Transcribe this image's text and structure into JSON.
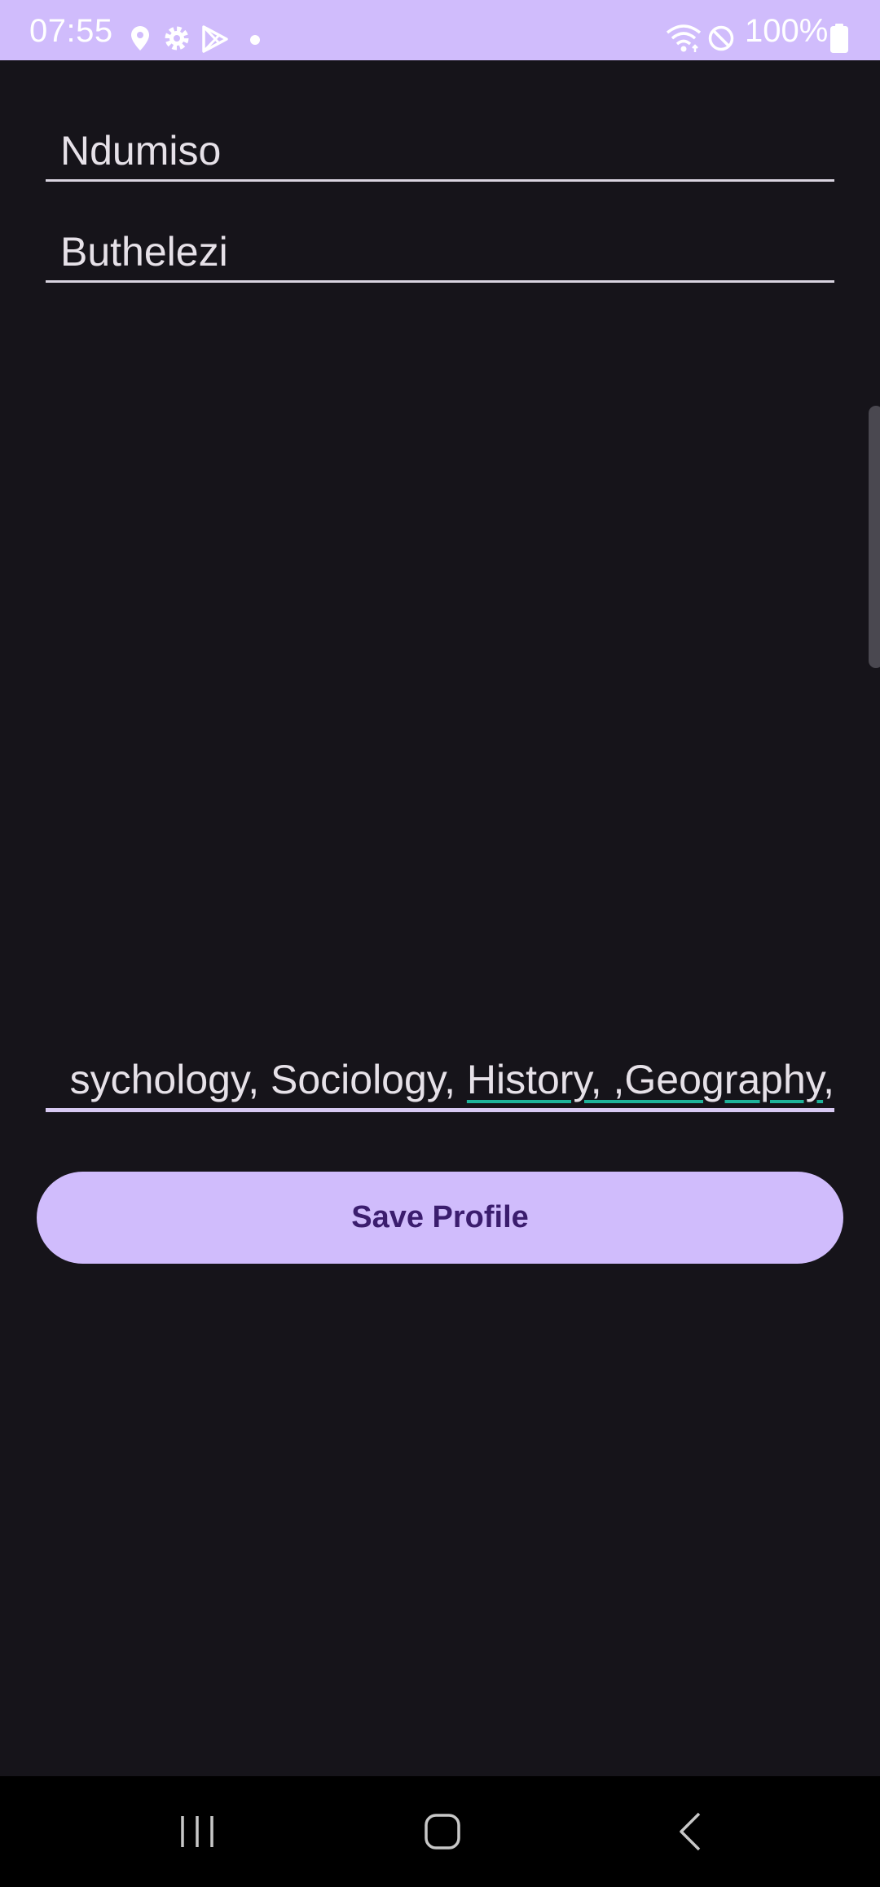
{
  "status_bar": {
    "time": "07:55",
    "battery_percent": "100%",
    "icons": [
      "location-icon",
      "settings-icon",
      "play-store-icon",
      "notification-dot-icon",
      "wifi-icon",
      "dnd-icon",
      "battery-icon"
    ]
  },
  "form": {
    "first_name": "Ndumiso",
    "last_name": "Buthelezi",
    "subjects": {
      "prefix": "sychology, Sociology, ",
      "misspelled": "History, ,Geography",
      "suffix": ","
    }
  },
  "actions": {
    "save_label": "Save Profile"
  },
  "nav_bar": {
    "buttons": [
      "recents-icon",
      "home-icon",
      "back-icon"
    ]
  },
  "colors": {
    "accent": "#d0bcfc",
    "background": "#16141a",
    "button_text": "#3b1d6e",
    "spellcheck_underline": "#1eb39a"
  }
}
